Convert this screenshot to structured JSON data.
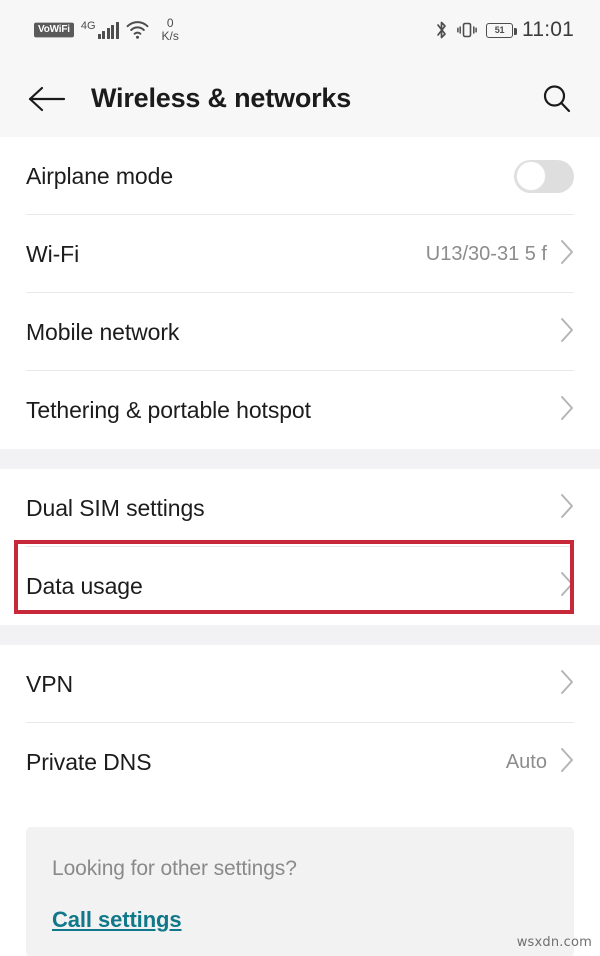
{
  "status_bar": {
    "vowifi_badge": "VoWiFi",
    "network_type": "4G",
    "signal_bars": 5,
    "wifi_icon": "wifi-icon",
    "data_speed_value": "0",
    "data_speed_unit": "K/s",
    "bluetooth_icon": "bluetooth-icon",
    "vibrate_icon": "vibrate-icon",
    "battery_level": "51",
    "time": "11:01"
  },
  "appbar": {
    "back_icon": "back-arrow-icon",
    "title": "Wireless & networks",
    "search_icon": "search-icon"
  },
  "groups": [
    {
      "rows": [
        {
          "label": "Airplane mode",
          "value": "",
          "control": "toggle",
          "toggle_on": false
        },
        {
          "label": "Wi-Fi",
          "value": "U13/30-31 5 f",
          "control": "chevron"
        },
        {
          "label": "Mobile network",
          "value": "",
          "control": "chevron"
        },
        {
          "label": "Tethering & portable hotspot",
          "value": "",
          "control": "chevron"
        }
      ]
    },
    {
      "rows": [
        {
          "label": "Dual SIM settings",
          "value": "",
          "control": "chevron"
        },
        {
          "label": "Data usage",
          "value": "",
          "control": "chevron",
          "highlighted": true
        }
      ]
    },
    {
      "rows": [
        {
          "label": "VPN",
          "value": "",
          "control": "chevron"
        },
        {
          "label": "Private DNS",
          "value": "Auto",
          "control": "chevron"
        }
      ]
    }
  ],
  "footer": {
    "prompt": "Looking for other settings?",
    "link_label": "Call settings"
  },
  "watermark": "wsxdn.com",
  "colors": {
    "highlight": "#c7283a",
    "link": "#11788a",
    "section_gap": "#f2f2f4",
    "appbar_bg": "#f7f7f8",
    "card_bg": "#f2f2f2"
  }
}
